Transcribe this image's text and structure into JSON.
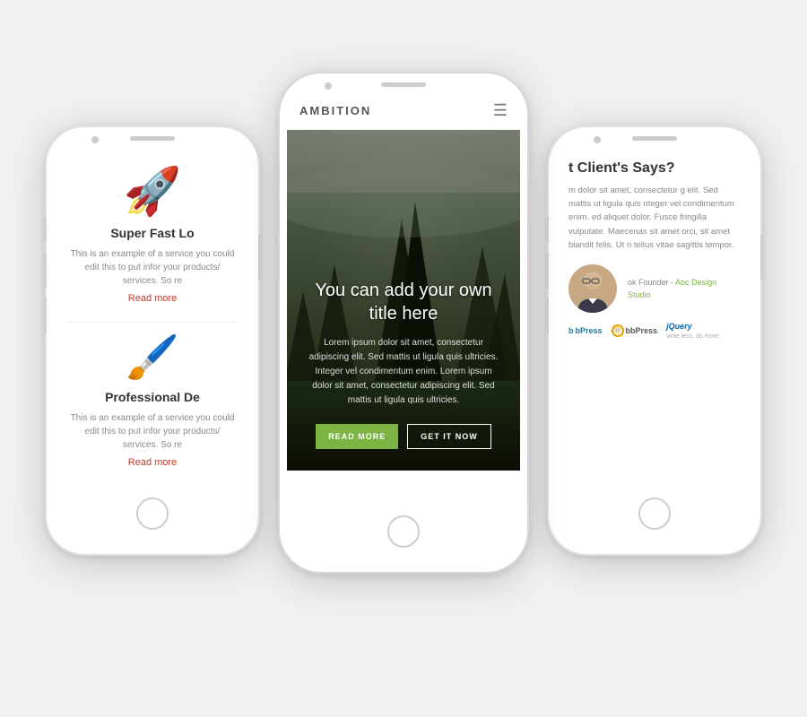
{
  "phones": {
    "left": {
      "service1": {
        "icon": "🚀",
        "title": "Super Fast Lo",
        "description": "This is an example of a service you could edit this to put infor your products/ services. So re",
        "readMore": "Read more"
      },
      "service2": {
        "icon": "🖌️",
        "title": "Professional De",
        "description": "This is an example of a service you could edit this to put infor your products/ services. So re",
        "readMore": "Read more"
      }
    },
    "center": {
      "brand": "AMBITION",
      "hero": {
        "title": "You can add your own title here",
        "body": "Lorem ipsum dolor sit amet, consectetur adipiscing elit. Sed mattis ut ligula quis ultricies. Integer vel condimentum enim. Lorem ipsum dolor sit amet, consectetur adipiscing elit. Sed mattis ut ligula quis ultricies.",
        "btn1": "READ MORE",
        "btn2": "GET IT NOW"
      }
    },
    "right": {
      "sectionTitle": "t Client's Says?",
      "testimonialText": "m dolor sit amet, consectetur g elit. Sed mattis ut ligula quis nteger vel condimentum enim. ed aliquet dolor. Fusce fringilla vulputate. Maecenas sit amet orci, sit amet blandit felis. Ut n tellus vitae sagittis tempor.",
      "author": {
        "role": "ok Founder",
        "studio": "Abc Design Studio"
      },
      "logos": {
        "wp": "bPress",
        "bb": "bbPress",
        "jquery": "jQuery"
      }
    }
  },
  "colors": {
    "accent_green": "#7cb342",
    "accent_red": "#c0392b",
    "studio_green": "#7cb342"
  }
}
